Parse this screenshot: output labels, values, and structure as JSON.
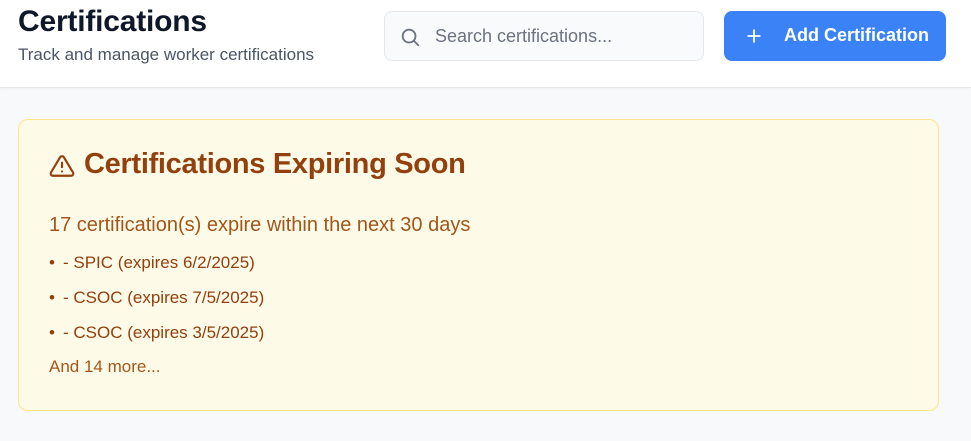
{
  "header": {
    "title": "Certifications",
    "subtitle": "Track and manage worker certifications"
  },
  "search": {
    "placeholder": "Search certifications...",
    "value": "",
    "icon": "search-icon"
  },
  "actions": {
    "add_label": "Add Certification",
    "add_icon": "plus-icon",
    "accent_color": "#3b82f6"
  },
  "alert": {
    "icon": "warning-triangle-icon",
    "title": "Certifications Expiring Soon",
    "summary": "17 certification(s) expire within the next 30 days",
    "items": [
      {
        "bullet": "•",
        "text": "- SPIC (expires 6/2/2025)"
      },
      {
        "bullet": "•",
        "text": "- CSOC (expires 7/5/2025)"
      },
      {
        "bullet": "•",
        "text": "- CSOC (expires 3/5/2025)"
      }
    ],
    "more": "And 14 more...",
    "background_color": "#fefae8",
    "border_color": "#fde68a",
    "text_color": "#92400e"
  }
}
